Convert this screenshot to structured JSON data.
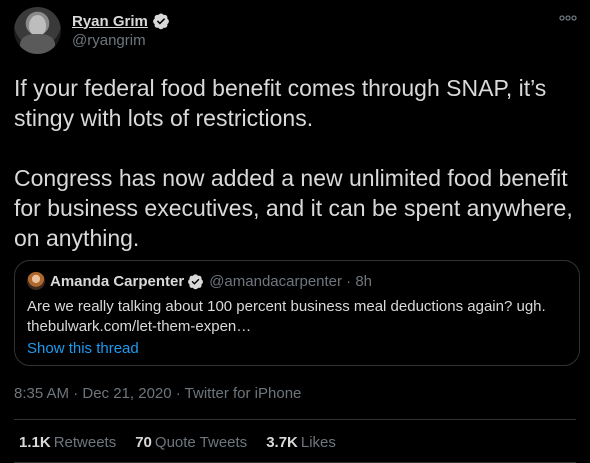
{
  "author": {
    "display_name": "Ryan Grim",
    "handle": "@ryangrim"
  },
  "tweet": {
    "text": "If your federal food benefit comes through SNAP, it’s stingy with lots of restrictions.\n\nCongress has now added a new unlimited food benefit for business executives, and it can be spent anywhere, on anything."
  },
  "quote": {
    "display_name": "Amanda Carpenter",
    "handle_time": "@amandacarpenter · 8h",
    "text": "Are we really talking about 100 percent business meal deductions again? ugh. thebulwark.com/let-them-expen…",
    "show_thread": "Show this thread"
  },
  "meta": {
    "timestamp_source": "8:35 AM · Dec 21, 2020 · Twitter for iPhone"
  },
  "stats": {
    "retweets_count": "1.1K",
    "retweets_label": "Retweets",
    "quotes_count": "70",
    "quotes_label": "Quote Tweets",
    "likes_count": "3.7K",
    "likes_label": "Likes"
  },
  "colors": {
    "background": "#000000",
    "text": "#d9d9d9",
    "muted": "#6e767d",
    "link": "#1d9bf0",
    "verified": "#d9d9d9"
  },
  "icons": {
    "verified": "verified-badge-icon",
    "more": "more-dots-icon"
  }
}
